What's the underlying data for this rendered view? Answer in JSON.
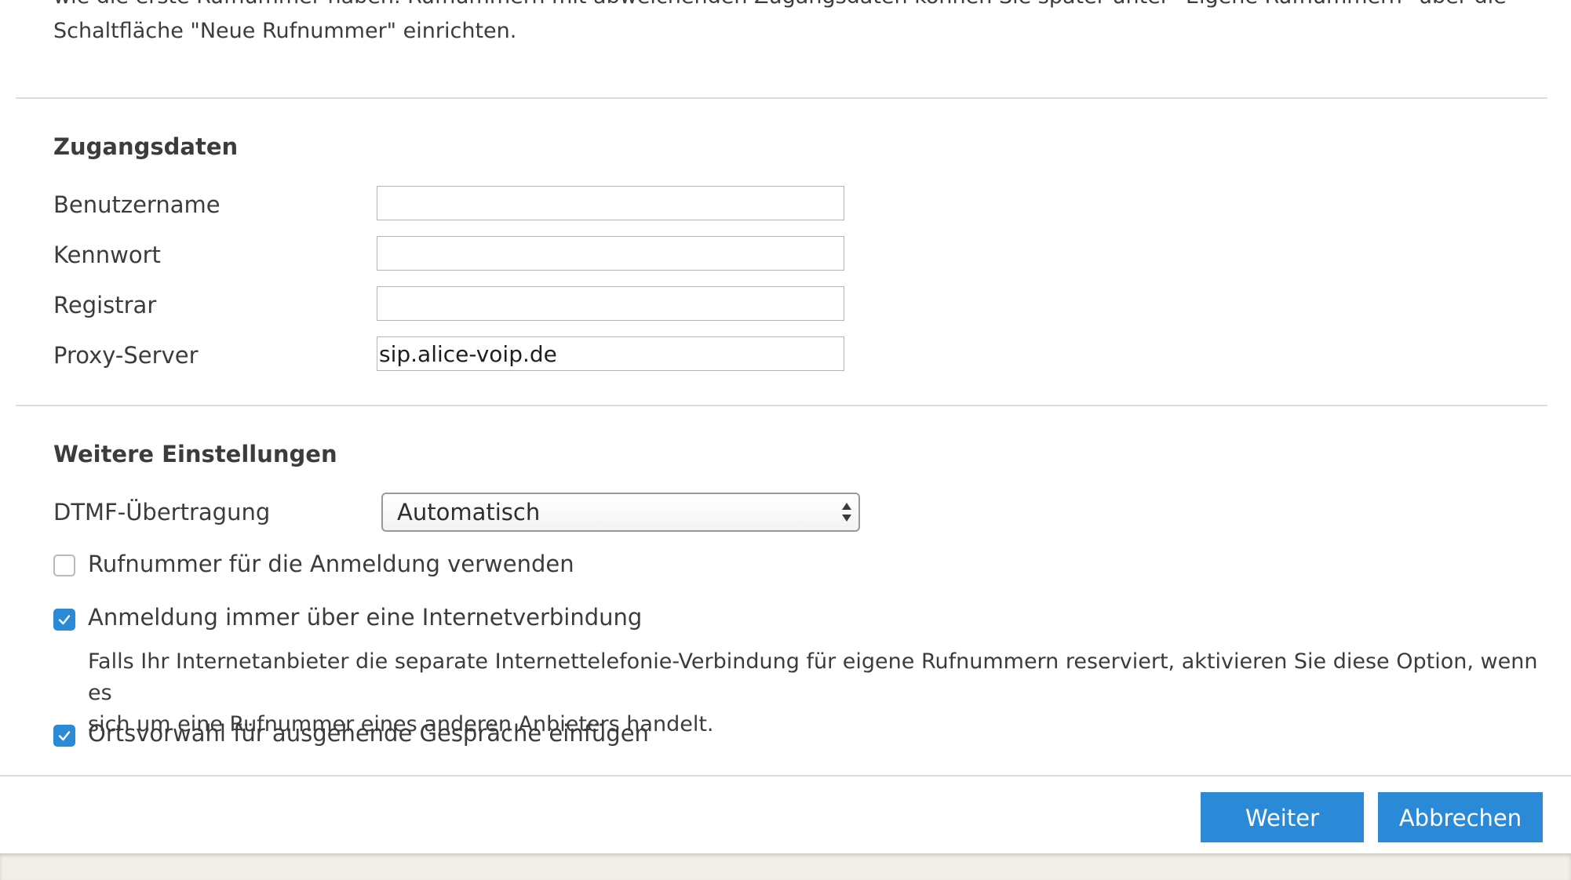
{
  "intro": {
    "line1": "wie die erste Rufnummer haben. Rufnummern mit abweichenden Zugangsdaten können Sie später unter \"Eigene Rufnummern\" über die",
    "line2": "Schaltfläche \"Neue Rufnummer\" einrichten."
  },
  "access": {
    "title": "Zugangsdaten",
    "username_label": "Benutzername",
    "username_value": "",
    "password_label": "Kennwort",
    "password_value": "",
    "registrar_label": "Registrar",
    "registrar_value": "",
    "proxy_label": "Proxy-Server",
    "proxy_value": "sip.alice-voip.de"
  },
  "more_settings": {
    "title": "Weitere Einstellungen",
    "dtmf_label": "DTMF-Übertragung",
    "dtmf_value": "Automatisch",
    "options": [
      {
        "label": "Rufnummer für die Anmeldung verwenden",
        "checked": false
      },
      {
        "label": "Anmeldung immer über eine Internetverbindung",
        "checked": true
      },
      {
        "label": "Ortsvorwahl für ausgehende Gespräche einfügen",
        "checked": true
      }
    ],
    "hint_line1": "Falls Ihr Internetanbieter die separate Internettelefonie-Verbindung für eigene Rufnummern reserviert, aktivieren Sie diese Option, wenn es",
    "hint_line2": "sich um eine Rufnummer eines anderen Anbieters handelt."
  },
  "buttons": {
    "next_label": "Weiter",
    "cancel_label": "Abbrechen"
  },
  "colors": {
    "accent": "#2b8ad8",
    "text": "#3c3c3c",
    "divider": "#dddddd",
    "footer_bg": "#f2eee8"
  },
  "icons": {
    "checkmark": "check-icon",
    "select_arrows": "select-updown-icon"
  }
}
